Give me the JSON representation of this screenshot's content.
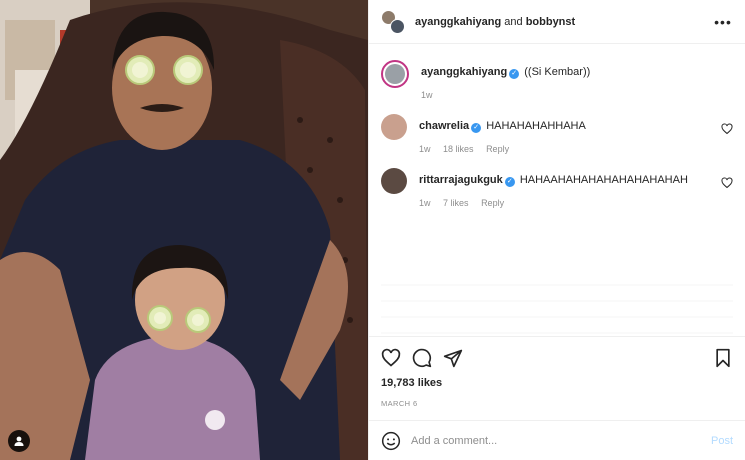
{
  "header": {
    "user1": "ayanggkahiyang",
    "joiner": "and",
    "user2": "bobbynst",
    "more_icon": "more-horizontal-icon"
  },
  "caption": {
    "username": "ayanggkahiyang",
    "text": "((Si Kembar))",
    "time": "1w"
  },
  "comments": [
    {
      "username": "chawrelia",
      "text": "HAHAHAHAHHAHA",
      "time": "1w",
      "likes": "18 likes",
      "reply": "Reply"
    },
    {
      "username": "rittarrajagukguk",
      "text": "HAHAAHAHAHAHAHAHAHAHAH",
      "time": "1w",
      "likes": "7 likes",
      "reply": "Reply"
    }
  ],
  "stats": {
    "likes": "19,783 likes",
    "date": "MARCH 6"
  },
  "add_comment": {
    "placeholder": "Add a comment...",
    "post_label": "Post"
  },
  "colors": {
    "verified": "#3897f0",
    "post_button_disabled": "#b3dbff",
    "story_ring": "#c13584"
  }
}
